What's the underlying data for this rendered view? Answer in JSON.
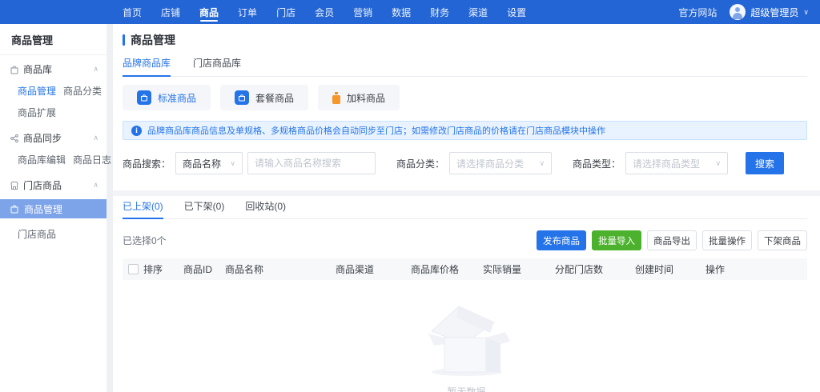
{
  "topnav": {
    "items": [
      "首页",
      "店铺",
      "商品",
      "订单",
      "门店",
      "会员",
      "营销",
      "数据",
      "财务",
      "渠道",
      "设置"
    ],
    "site_link": "官方网站",
    "user_name": "超级管理员"
  },
  "sidebar": {
    "title": "商品管理",
    "sec1_label": "商品库",
    "sec1_item1": "商品管理",
    "sec1_item2": "商品分类",
    "sec1_item3": "商品扩展",
    "sec2_label": "商品同步",
    "sec2_item1": "商品库编辑",
    "sec2_item2": "商品日志",
    "sec3_label": "门店商品",
    "sec3_item1": "商品管理",
    "sec3_item2": "门店商品"
  },
  "main": {
    "page_title": "商品管理",
    "library_tabs": {
      "brand": "品牌商品库",
      "store": "门店商品库"
    },
    "quick_buttons": {
      "standard": "标准商品",
      "combo": "套餐商品",
      "topping": "加料商品"
    },
    "banner": {
      "text": "品牌商品库商品信息及单规格、多规格商品价格会自动同步至门店；如需修改门店商品的价格请在门店商品模块中操作"
    },
    "filters": {
      "search_label": "商品搜索：",
      "search_type_value": "商品名称",
      "search_placeholder": "请输入商品名称搜索",
      "category_label": "商品分类：",
      "category_placeholder": "请选择商品分类",
      "type_label": "商品类型：",
      "type_placeholder": "请选择商品类型",
      "search_button": "搜索"
    },
    "status_tabs": {
      "on_shelf": "已上架(0)",
      "off_shelf": "已下架(0)",
      "recycle": "回收站(0)"
    },
    "selection": {
      "text": "已选择0个"
    },
    "actions": {
      "publish": "发布商品",
      "batch_import": "批量导入",
      "export": "商品导出",
      "batch_ops": "批量操作",
      "take_down": "下架商品"
    },
    "table": {
      "headers": [
        "排序",
        "商品ID",
        "商品名称",
        "商品渠道",
        "商品库价格",
        "实际销量",
        "分配门店数",
        "创建时间",
        "操作"
      ]
    },
    "empty": {
      "text": "暂无数据"
    }
  },
  "icons": {
    "chevron_down": "∨",
    "chevron_up": "∧"
  },
  "colors": {
    "topbar": "#2365d4",
    "primary": "#2573e8",
    "green": "#4cb22d",
    "sidebar_highlight": "#7da3e8",
    "banner_bg": "#e8f3ff",
    "topping_orange": "#f5972b"
  }
}
